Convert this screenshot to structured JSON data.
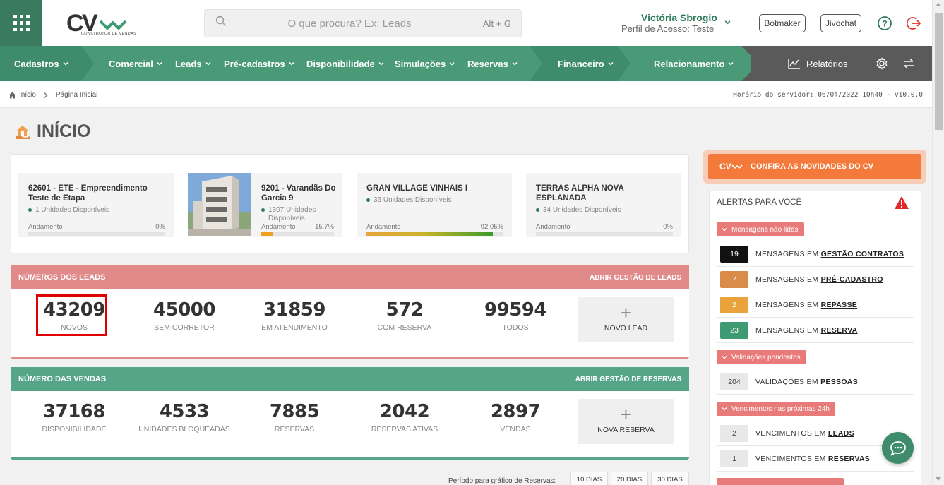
{
  "header": {
    "logo_text": "CV",
    "logo_tagline": "CONSTRUTOR DE VENDAS",
    "search_placeholder": "O que procura? Ex: Leads",
    "search_shortcut": "Alt + G",
    "user_name": "Victória Sbrogio",
    "user_profile": "Perfil de Acesso: Teste",
    "botmaker_label": "Botmaker",
    "jivochat_label": "Jivochat"
  },
  "nav": {
    "cadastros": "Cadastros",
    "comercial": "Comercial",
    "leads": "Leads",
    "pre_cadastros": "Pré-cadastros",
    "disponibilidade": "Disponibilidade",
    "simulacoes": "Simulações",
    "reservas": "Reservas",
    "financeiro": "Financeiro",
    "relacionamento": "Relacionamento",
    "relatorios": "Relatórios"
  },
  "breadcrumb": {
    "home": "Início",
    "current": "Página Inicial",
    "server_time": "Horário do servidor: 06/04/2022 10h40 - v10.0.0"
  },
  "page": {
    "title": "INÍCIO"
  },
  "enterprises": [
    {
      "name": "62601 - ETE - Empreendimento Teste de Etapa",
      "units": "1 Unidades Disponíveis",
      "progress_label": "Andamento",
      "progress": "0%",
      "progress_value": 0
    },
    {
      "name": "9201 - Varandãs Do Garcia 9",
      "units": "1307 Unidades Disponíveis",
      "progress_label": "Andamento",
      "progress": "15.7%",
      "progress_value": 15.7
    },
    {
      "name": "GRAN VILLAGE VINHAIS I",
      "units": "36 Unidades Disponíveis",
      "progress_label": "Andamento",
      "progress": "92.05%",
      "progress_value": 92.05
    },
    {
      "name": "TERRAS ALPHA NOVA ESPLANADA",
      "units": "34 Unidades Disponíveis",
      "progress_label": "Andamento",
      "progress": "0%",
      "progress_value": 0
    }
  ],
  "leads": {
    "title": "NÚMEROS DOS LEADS",
    "link": "ABRIR GESTÃO DE LEADS",
    "stats": [
      {
        "value": "43209",
        "label": "NOVOS"
      },
      {
        "value": "45000",
        "label": "SEM CORRETOR"
      },
      {
        "value": "31859",
        "label": "EM ATENDIMENTO"
      },
      {
        "value": "572",
        "label": "COM RESERVA"
      },
      {
        "value": "99594",
        "label": "TODOS"
      }
    ],
    "new_button": "NOVO LEAD"
  },
  "sales": {
    "title": "NÚMERO DAS VENDAS",
    "link": "ABRIR GESTÃO DE RESERVAS",
    "stats": [
      {
        "value": "37168",
        "label": "DISPONIBILIDADE"
      },
      {
        "value": "4533",
        "label": "UNIDADES BLOQUEADAS"
      },
      {
        "value": "7885",
        "label": "RESERVAS"
      },
      {
        "value": "2042",
        "label": "RESERVAS ATIVAS"
      },
      {
        "value": "2897",
        "label": "VENDAS"
      }
    ],
    "new_button": "NOVA RESERVA"
  },
  "period": {
    "label": "Período para gráfico de Reservas:",
    "options": [
      "10 DIAS",
      "20 DIAS",
      "30 DIAS"
    ]
  },
  "news": {
    "label": "CONFIRA AS NOVIDADES DO CV"
  },
  "alerts": {
    "title": "ALERTAS PARA VOCÊ",
    "groups": [
      {
        "tag": "Mensagens não lidas",
        "rows": [
          {
            "count": "19",
            "text": "MENSAGENS EM",
            "link": "GESTÃO CONTRATOS",
            "color": "#111111"
          },
          {
            "count": "7",
            "text": "MENSAGENS EM",
            "link": "PRÉ-CADASTRO",
            "color": "#d98c4a"
          },
          {
            "count": "2",
            "text": "MENSAGENS EM",
            "link": "REPASSE",
            "color": "#e9a33a"
          },
          {
            "count": "23",
            "text": "MENSAGENS EM",
            "link": "RESERVA",
            "color": "#3e9a72"
          }
        ]
      },
      {
        "tag": "Validações pendentes",
        "rows": [
          {
            "count": "204",
            "text": "VALIDAÇÕES EM",
            "link": "PESSOAS",
            "color": "#e8e8e8"
          }
        ]
      },
      {
        "tag": "Vencimentos nas próximas 24h",
        "rows": [
          {
            "count": "2",
            "text": "VENCIMENTOS EM",
            "link": "LEADS",
            "color": "#e8e8e8"
          },
          {
            "count": "1",
            "text": "VENCIMENTOS EM",
            "link": "RESERVAS",
            "color": "#e8e8e8"
          }
        ]
      }
    ]
  },
  "colors": {
    "brand_green": "#3a7a5e",
    "nav_green": "#4a9a78",
    "leads_header": "#e08a8a",
    "sales_header": "#56a588",
    "news_orange": "#f37a3a",
    "alert_tag": "#e97a7a"
  }
}
